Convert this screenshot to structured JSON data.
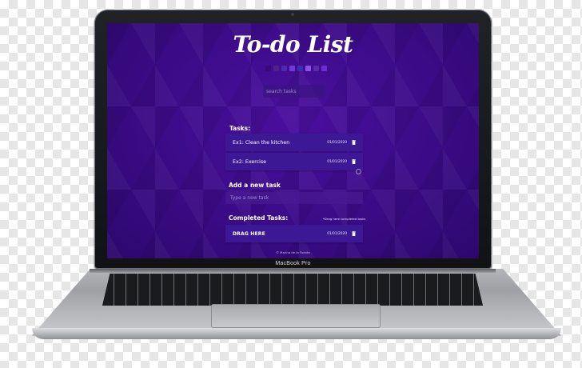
{
  "app": {
    "title": "To-do List",
    "footer": "© Marina de la Fuente"
  },
  "device": {
    "brand_label": "MacBook Pro"
  },
  "theme": {
    "colors": [
      "#3b0a7a",
      "#52208c",
      "#4b2cb1",
      "#6f3ad0",
      "#3a2fb0",
      "#8c53e0",
      "#5b2aa6",
      "#6d2ad7"
    ]
  },
  "search": {
    "placeholder": "search tasks"
  },
  "tasks": {
    "label": "Tasks:",
    "items": [
      {
        "name": "Ex1: Clean the kitchen",
        "date": "01/01/2020"
      },
      {
        "name": "Ex2: Exercise",
        "date": "01/01/2020"
      }
    ]
  },
  "add_task": {
    "label": "Add a new task",
    "placeholder": "Type a new task"
  },
  "completed": {
    "label": "Completed Tasks:",
    "hint": "*Drag here completed tasks",
    "items": [
      {
        "name": "DRAG HERE",
        "date": "01/01/2020"
      }
    ]
  }
}
